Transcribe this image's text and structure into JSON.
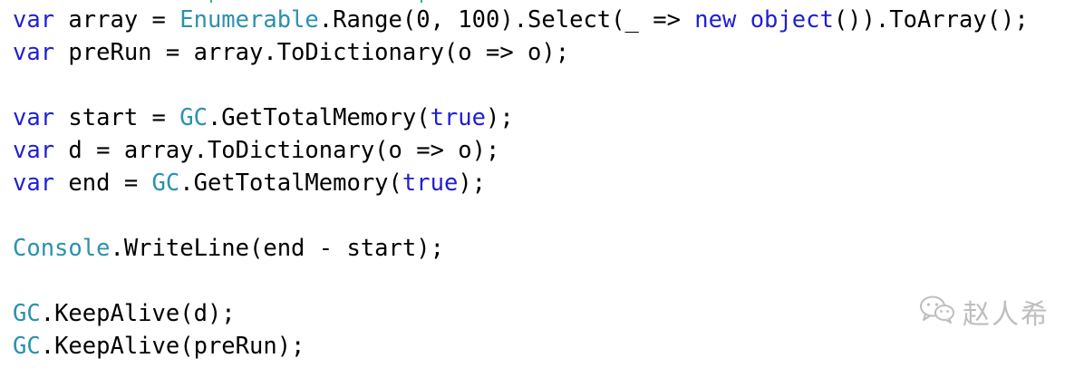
{
  "editor": {
    "lines": [
      [
        {
          "cls": "kw",
          "text": "var"
        },
        {
          "cls": "plain",
          "text": " array = "
        },
        {
          "cls": "type",
          "text": "Enumerable"
        },
        {
          "cls": "plain",
          "text": ".Range(0, 100).Select(_ => "
        },
        {
          "cls": "kw",
          "text": "new"
        },
        {
          "cls": "plain",
          "text": " "
        },
        {
          "cls": "kw",
          "text": "object"
        },
        {
          "cls": "plain",
          "text": "()).ToArray();"
        }
      ],
      [
        {
          "cls": "kw",
          "text": "var"
        },
        {
          "cls": "plain",
          "text": " preRun = array.ToDictionary(o => o);"
        }
      ],
      [],
      [
        {
          "cls": "kw",
          "text": "var"
        },
        {
          "cls": "plain",
          "text": " start = "
        },
        {
          "cls": "type",
          "text": "GC"
        },
        {
          "cls": "plain",
          "text": ".GetTotalMemory("
        },
        {
          "cls": "kw",
          "text": "true"
        },
        {
          "cls": "plain",
          "text": ");"
        }
      ],
      [
        {
          "cls": "kw",
          "text": "var"
        },
        {
          "cls": "plain",
          "text": " d = array.ToDictionary(o => o);"
        }
      ],
      [
        {
          "cls": "kw",
          "text": "var"
        },
        {
          "cls": "plain",
          "text": " end = "
        },
        {
          "cls": "type",
          "text": "GC"
        },
        {
          "cls": "plain",
          "text": ".GetTotalMemory("
        },
        {
          "cls": "kw",
          "text": "true"
        },
        {
          "cls": "plain",
          "text": ");"
        }
      ],
      [],
      [
        {
          "cls": "type",
          "text": "Console"
        },
        {
          "cls": "plain",
          "text": ".WriteLine(end - start);"
        }
      ],
      [],
      [
        {
          "cls": "type",
          "text": "GC"
        },
        {
          "cls": "plain",
          "text": ".KeepAlive(d);"
        }
      ],
      [
        {
          "cls": "type",
          "text": "GC"
        },
        {
          "cls": "plain",
          "text": ".KeepAlive(preRun);"
        }
      ]
    ]
  },
  "watermark": {
    "icon": "wechat-icon",
    "text": "赵人希"
  },
  "colors": {
    "keyword": "#1f1fd2",
    "type": "#2b91af",
    "plain": "#000000",
    "background": "#ffffff"
  }
}
